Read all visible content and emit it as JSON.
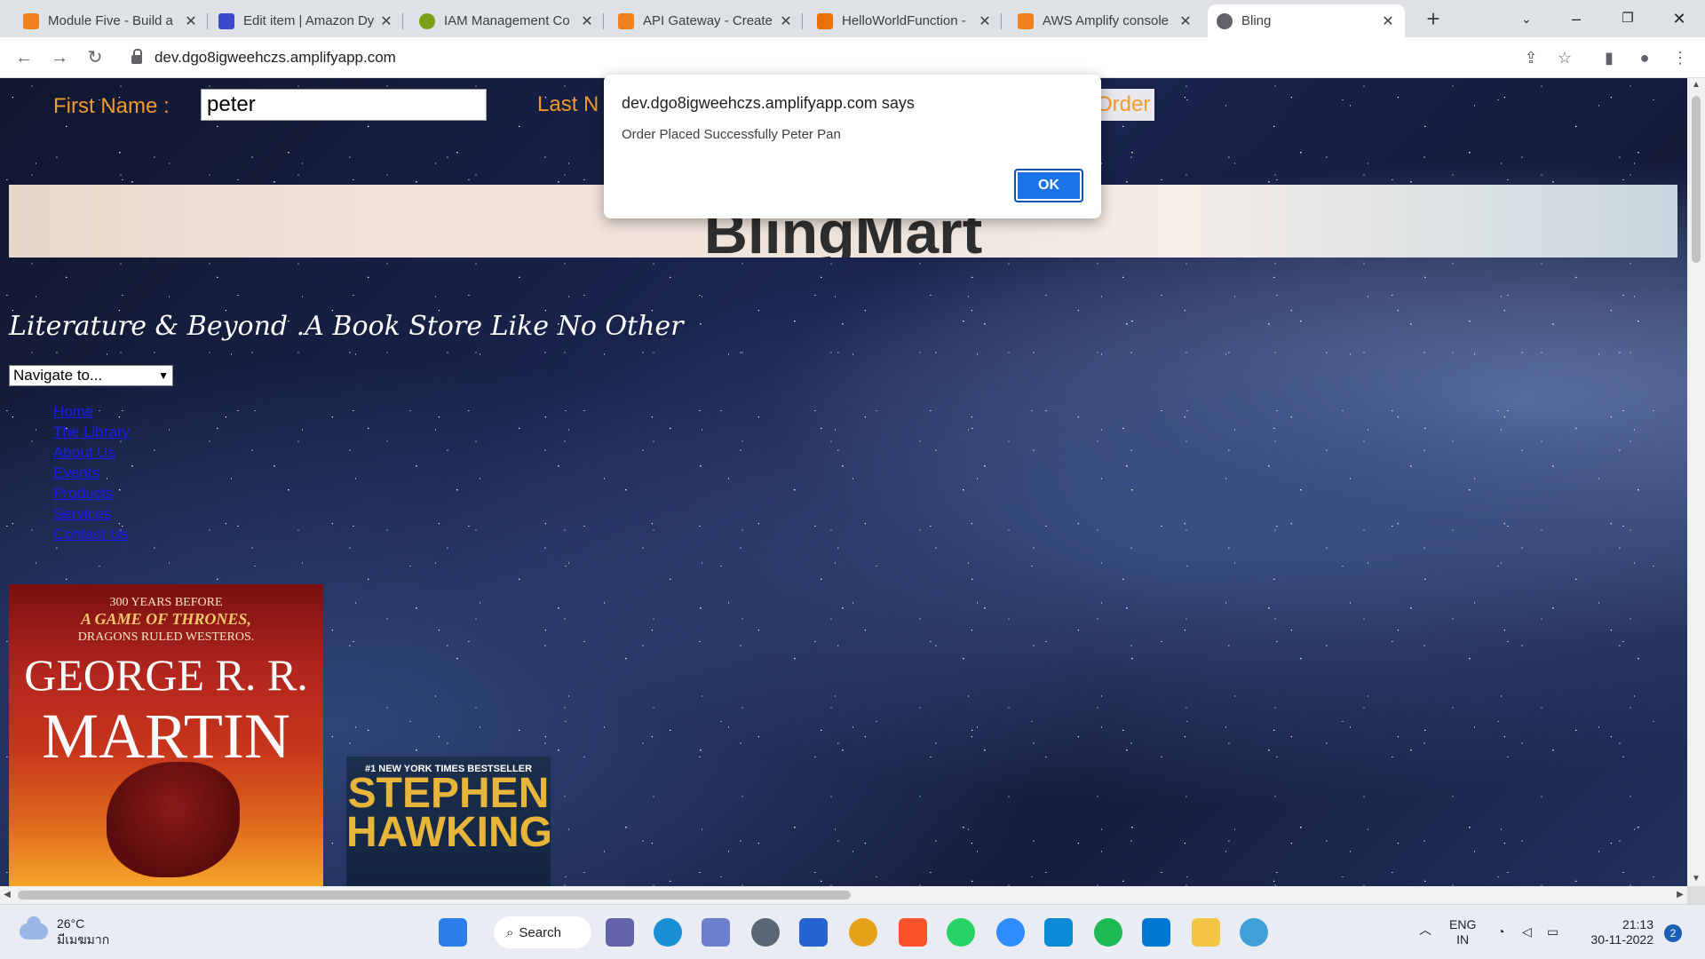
{
  "browser": {
    "tabs": [
      {
        "label": "Module Five - Build a",
        "favicon_color": "#f0821e"
      },
      {
        "label": "Edit item | Amazon Dy",
        "favicon_color": "#3b48cc"
      },
      {
        "label": "IAM Management Co",
        "favicon_color": "#7aa116"
      },
      {
        "label": "API Gateway - Create",
        "favicon_color": "#f0821e"
      },
      {
        "label": "HelloWorldFunction -",
        "favicon_color": "#e8710a"
      },
      {
        "label": "AWS Amplify console",
        "favicon_color": "#f0821e"
      },
      {
        "label": "Bling",
        "favicon_color": "#5f6368"
      }
    ],
    "url": "dev.dgo8igweehczs.amplifyapp.com"
  },
  "page": {
    "first_name_label": "First Name :",
    "first_name_value": "peter",
    "last_name_label": "Last N",
    "order_button": "Order",
    "banner_title": "BlingMart",
    "tagline": "Literature & Beyond .A Book Store Like No Other",
    "nav_select": "Navigate to...",
    "nav_links": [
      "Home",
      "The Library",
      "About Us",
      "Events",
      "Products",
      "Services",
      "Contact Us"
    ],
    "book1": {
      "line1": "300 YEARS BEFORE",
      "line2": "A GAME OF THRONES,",
      "line3": "DRAGONS RULED WESTEROS.",
      "author1": "GEORGE R. R.",
      "author2": "MARTIN"
    },
    "book2": {
      "tag": "#1 NEW YORK TIMES BESTSELLER",
      "author1": "STEPHEN",
      "author2": "HAWKING"
    }
  },
  "dialog": {
    "title": "dev.dgo8igweehczs.amplifyapp.com says",
    "message": "Order Placed Successfully Peter Pan",
    "ok": "OK"
  },
  "taskbar": {
    "temperature": "26°C",
    "weather_text": "มีเมฆมาก",
    "search_label": "Search",
    "lang1": "ENG",
    "lang2": "IN",
    "time": "21:13",
    "date": "30-11-2022",
    "notification_count": "2"
  }
}
